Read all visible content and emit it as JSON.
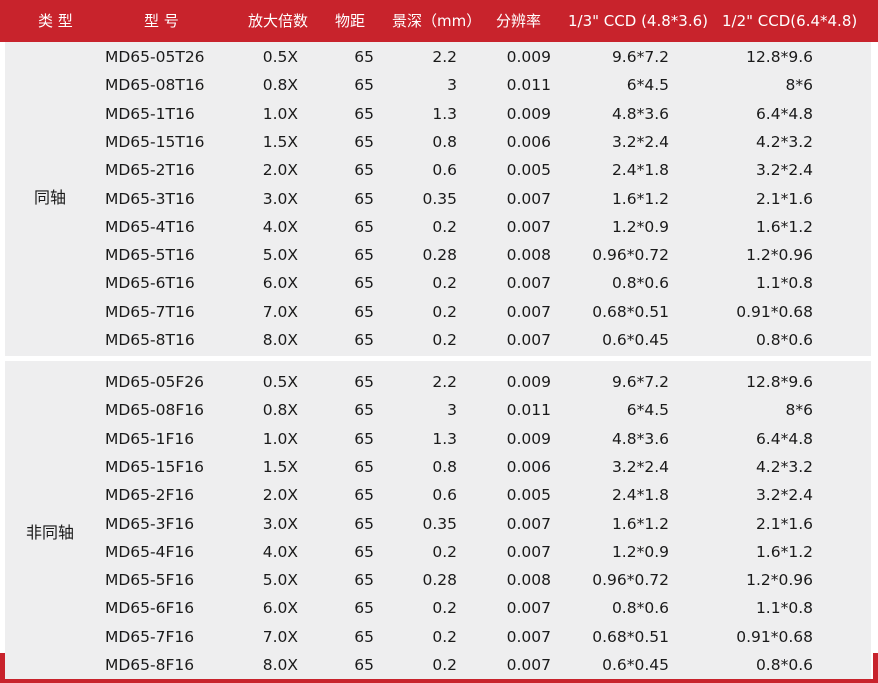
{
  "header": {
    "type": "类 型",
    "model": "型 号",
    "magnification": "放大倍数",
    "working_distance": "物距",
    "depth_of_field": "景深（mm）",
    "resolution": "分辨率",
    "ccd_1_3": "1/3\" CCD (4.8*3.6)",
    "ccd_1_2": "1/2\" CCD(6.4*4.8)"
  },
  "groups": [
    {
      "label": "同轴",
      "rows": [
        {
          "model": "MD65-05T26",
          "mag": "0.5X",
          "dist": "65",
          "dof": "2.2",
          "res": "0.009",
          "ccd3": "9.6*7.2",
          "ccd2": "12.8*9.6"
        },
        {
          "model": "MD65-08T16",
          "mag": "0.8X",
          "dist": "65",
          "dof": "3",
          "res": "0.011",
          "ccd3": "6*4.5",
          "ccd2": "8*6"
        },
        {
          "model": "MD65-1T16",
          "mag": "1.0X",
          "dist": "65",
          "dof": "1.3",
          "res": "0.009",
          "ccd3": "4.8*3.6",
          "ccd2": "6.4*4.8"
        },
        {
          "model": "MD65-15T16",
          "mag": "1.5X",
          "dist": "65",
          "dof": "0.8",
          "res": "0.006",
          "ccd3": "3.2*2.4",
          "ccd2": "4.2*3.2"
        },
        {
          "model": "MD65-2T16",
          "mag": "2.0X",
          "dist": "65",
          "dof": "0.6",
          "res": "0.005",
          "ccd3": "2.4*1.8",
          "ccd2": "3.2*2.4"
        },
        {
          "model": "MD65-3T16",
          "mag": "3.0X",
          "dist": "65",
          "dof": "0.35",
          "res": "0.007",
          "ccd3": "1.6*1.2",
          "ccd2": "2.1*1.6"
        },
        {
          "model": "MD65-4T16",
          "mag": "4.0X",
          "dist": "65",
          "dof": "0.2",
          "res": "0.007",
          "ccd3": "1.2*0.9",
          "ccd2": "1.6*1.2"
        },
        {
          "model": "MD65-5T16",
          "mag": "5.0X",
          "dist": "65",
          "dof": "0.28",
          "res": "0.008",
          "ccd3": "0.96*0.72",
          "ccd2": "1.2*0.96"
        },
        {
          "model": "MD65-6T16",
          "mag": "6.0X",
          "dist": "65",
          "dof": "0.2",
          "res": "0.007",
          "ccd3": "0.8*0.6",
          "ccd2": "1.1*0.8"
        },
        {
          "model": "MD65-7T16",
          "mag": "7.0X",
          "dist": "65",
          "dof": "0.2",
          "res": "0.007",
          "ccd3": "0.68*0.51",
          "ccd2": "0.91*0.68"
        },
        {
          "model": "MD65-8T16",
          "mag": "8.0X",
          "dist": "65",
          "dof": "0.2",
          "res": "0.007",
          "ccd3": "0.6*0.45",
          "ccd2": "0.8*0.6"
        }
      ]
    },
    {
      "label": "非同轴",
      "rows": [
        {
          "model": "MD65-05F26",
          "mag": "0.5X",
          "dist": "65",
          "dof": "2.2",
          "res": "0.009",
          "ccd3": "9.6*7.2",
          "ccd2": "12.8*9.6"
        },
        {
          "model": "MD65-08F16",
          "mag": "0.8X",
          "dist": "65",
          "dof": "3",
          "res": "0.011",
          "ccd3": "6*4.5",
          "ccd2": "8*6"
        },
        {
          "model": "MD65-1F16",
          "mag": "1.0X",
          "dist": "65",
          "dof": "1.3",
          "res": "0.009",
          "ccd3": "4.8*3.6",
          "ccd2": "6.4*4.8"
        },
        {
          "model": "MD65-15F16",
          "mag": "1.5X",
          "dist": "65",
          "dof": "0.8",
          "res": "0.006",
          "ccd3": "3.2*2.4",
          "ccd2": "4.2*3.2"
        },
        {
          "model": "MD65-2F16",
          "mag": "2.0X",
          "dist": "65",
          "dof": "0.6",
          "res": "0.005",
          "ccd3": "2.4*1.8",
          "ccd2": "3.2*2.4"
        },
        {
          "model": "MD65-3F16",
          "mag": "3.0X",
          "dist": "65",
          "dof": "0.35",
          "res": "0.007",
          "ccd3": "1.6*1.2",
          "ccd2": "2.1*1.6"
        },
        {
          "model": "MD65-4F16",
          "mag": "4.0X",
          "dist": "65",
          "dof": "0.2",
          "res": "0.007",
          "ccd3": "1.2*0.9",
          "ccd2": "1.6*1.2"
        },
        {
          "model": "MD65-5F16",
          "mag": "5.0X",
          "dist": "65",
          "dof": "0.28",
          "res": "0.008",
          "ccd3": "0.96*0.72",
          "ccd2": "1.2*0.96"
        },
        {
          "model": "MD65-6F16",
          "mag": "6.0X",
          "dist": "65",
          "dof": "0.2",
          "res": "0.007",
          "ccd3": "0.8*0.6",
          "ccd2": "1.1*0.8"
        },
        {
          "model": "MD65-7F16",
          "mag": "7.0X",
          "dist": "65",
          "dof": "0.2",
          "res": "0.007",
          "ccd3": "0.68*0.51",
          "ccd2": "0.91*0.68"
        },
        {
          "model": "MD65-8F16",
          "mag": "8.0X",
          "dist": "65",
          "dof": "0.2",
          "res": "0.007",
          "ccd3": "0.6*0.45",
          "ccd2": "0.8*0.6"
        }
      ]
    }
  ],
  "colors": {
    "accent": "#c8232c",
    "row_background": "#eeeeef",
    "header_text": "#ffffff"
  }
}
